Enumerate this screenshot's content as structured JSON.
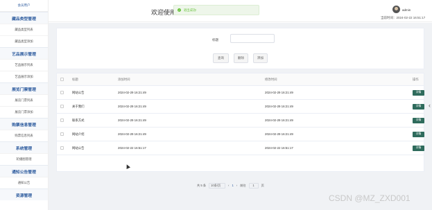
{
  "sidebar": {
    "user_label": "会员用户",
    "groups": [
      {
        "title": "藏品类型管理",
        "items": [
          "藏品类型列表",
          "藏品类型添加"
        ]
      },
      {
        "title": "艺品展示管理",
        "items": [
          "艺品展示列表",
          "艺品展示添加"
        ]
      },
      {
        "title": "展览门票管理",
        "items": [
          "展览门票列表",
          "展览门票添加"
        ]
      },
      {
        "title": "购票信息管理",
        "items": [
          "购票信息列表"
        ]
      },
      {
        "title": "系统管理",
        "items": [
          "轮播图管理"
        ]
      },
      {
        "title": "通知公告管理",
        "items": [
          "通知公告"
        ]
      },
      {
        "title": "资源管理",
        "items": []
      }
    ]
  },
  "header": {
    "welcome": "欢迎使用",
    "toast_text": "退出成功!",
    "username": "admin",
    "login_time": "当前时间：2024-02-22 16:51:17"
  },
  "search": {
    "label": "标题",
    "placeholder": "",
    "buttons": {
      "query": "查询",
      "delete": "删除",
      "add": "添加"
    }
  },
  "table": {
    "columns": [
      "标题",
      "添加时间",
      "修改时间",
      "操作"
    ],
    "rows": [
      {
        "title": "网站公告",
        "created": "2024-02-29 16:21:49",
        "updated": "2024-02-29 16:21:49",
        "action": "详情"
      },
      {
        "title": "关于我们",
        "created": "2024-02-29 16:21:49",
        "updated": "2024-02-29 16:21:49",
        "action": "详情"
      },
      {
        "title": "联系方式",
        "created": "2024-02-29 16:21:49",
        "updated": "2024-02-29 16:21:49",
        "action": "详情"
      },
      {
        "title": "网站介绍",
        "created": "2024-02-29 16:21:49",
        "updated": "2024-02-29 16:21:49",
        "action": "详情"
      },
      {
        "title": "网站公告",
        "created": "2024-02-22 16:51:17",
        "updated": "2024-02-22 16:51:17",
        "action": "详情"
      }
    ]
  },
  "pager": {
    "total": "共 5 条",
    "page_size": "10条/页",
    "prev": "‹",
    "current": "1",
    "next": "›",
    "goto_prefix": "前往",
    "goto_value": "1",
    "goto_suffix": "页"
  },
  "watermark": "CSDN @MZ_ZXD001",
  "colors": {
    "accent": "#2d5b9e",
    "detail_button": "#2e6b5c",
    "toast_green": "#67c23a"
  }
}
